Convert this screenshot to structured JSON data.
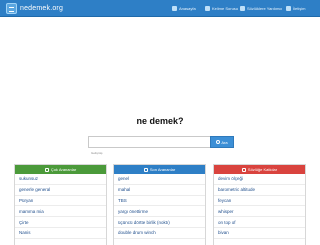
{
  "header": {
    "logo_text": "nedemek.org",
    "nav": [
      {
        "label": "Anasayfa",
        "icon": "home-icon"
      },
      {
        "label": "Kelime Sorusu",
        "icon": "question-icon"
      },
      {
        "label": "Sözlüklere Yardımcı",
        "icon": "book-icon"
      },
      {
        "label": "İletişim",
        "icon": "mail-icon"
      }
    ]
  },
  "main": {
    "title": "ne demek?",
    "search": {
      "placeholder": "",
      "button_label": "Ara"
    },
    "small_link": "Gelişmiş"
  },
  "columns": [
    {
      "heading": "Çok Arananlar",
      "color": "#4b9a3a",
      "items": [
        "sukunsuz",
        "generle general",
        "Püryan",
        "mamma mia",
        "Çirte",
        "Nanis"
      ]
    },
    {
      "heading": "Son Arananlar",
      "color": "#2e7fc6",
      "items": [
        "genel",
        "mahal",
        "TBS",
        "yargı önettirme",
        "üçüncü dörtte birlik (noktı)",
        "double drum winch"
      ]
    },
    {
      "heading": "Sözlüğe Katkılar",
      "color": "#d9433e",
      "items": [
        "devim ölçeği",
        "barometric altitude",
        "feycan",
        "whisper",
        "on top of",
        "bivan"
      ]
    }
  ]
}
